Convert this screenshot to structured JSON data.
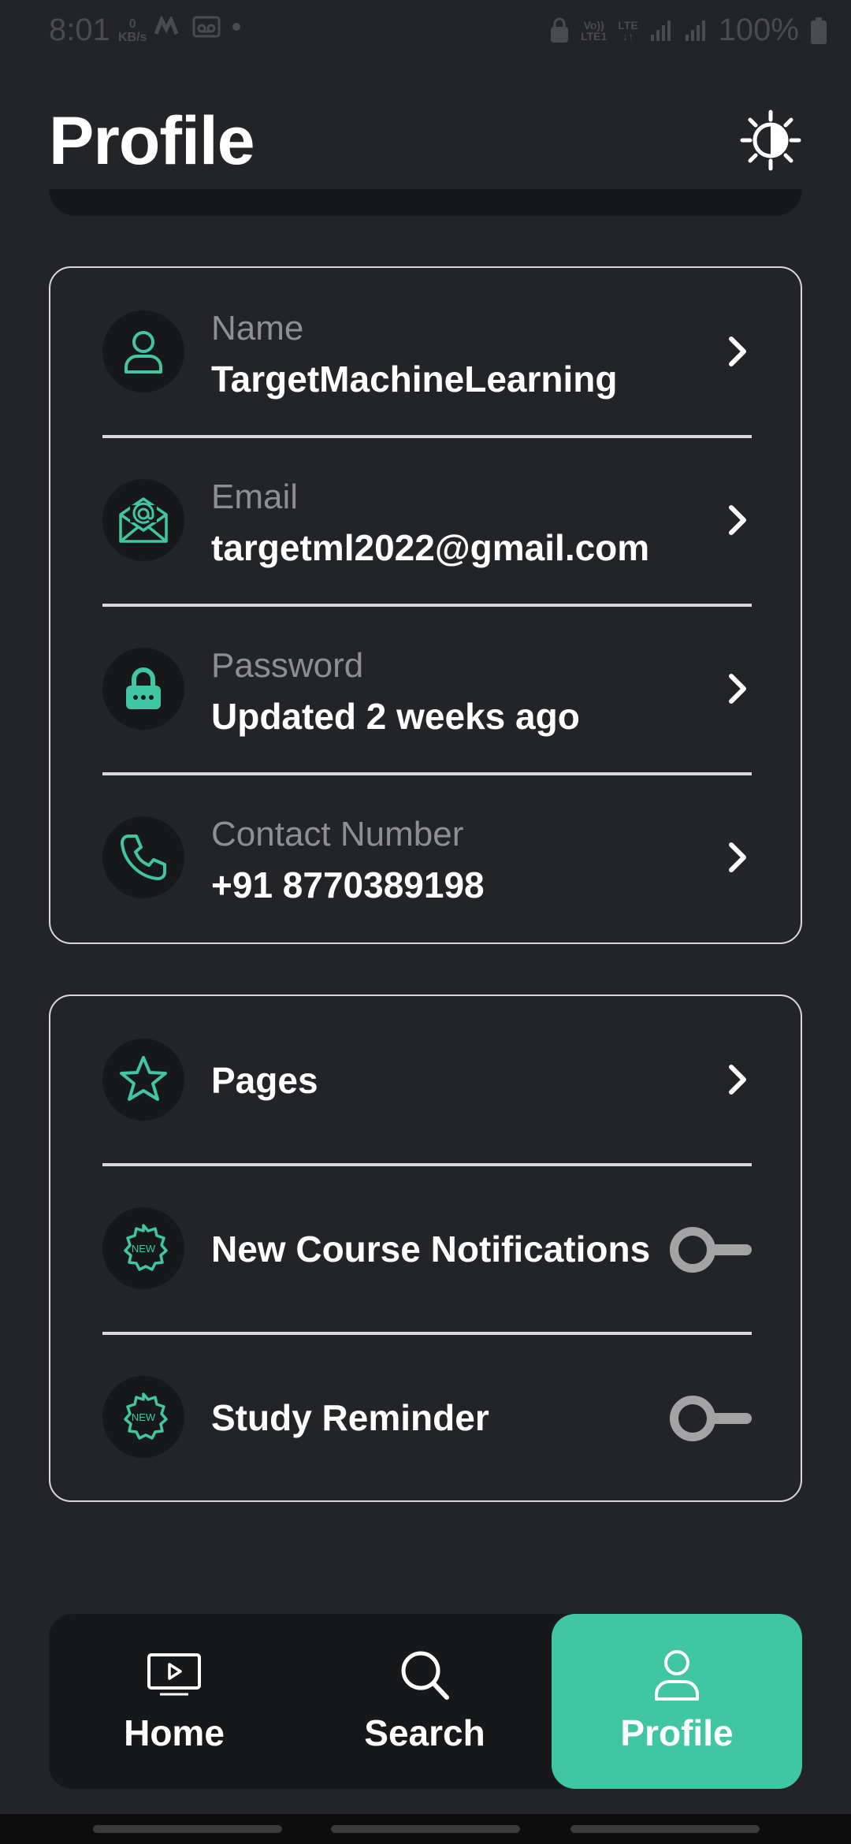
{
  "status_bar": {
    "time": "8:01",
    "net_speed_value": "0",
    "net_speed_unit": "KB/s",
    "network_volte": "Vo))",
    "network_lte1": "LTE1",
    "network_lte": "LTE",
    "battery": "100%"
  },
  "header": {
    "title": "Profile"
  },
  "account": {
    "items": [
      {
        "label": "Name",
        "value": "TargetMachineLearning",
        "icon": "user-icon"
      },
      {
        "label": "Email",
        "value": "targetml2022@gmail.com",
        "icon": "email-icon"
      },
      {
        "label": "Password",
        "value": "Updated 2 weeks ago",
        "icon": "lock-icon"
      },
      {
        "label": "Contact Number",
        "value": "+91 8770389198",
        "icon": "phone-icon"
      }
    ]
  },
  "settings": {
    "items": [
      {
        "label": "Pages",
        "icon": "star-icon",
        "control": "chevron"
      },
      {
        "label": "New Course Notifications",
        "icon": "new-badge-icon",
        "control": "toggle",
        "enabled": false
      },
      {
        "label": "Study Reminder",
        "icon": "new-badge-icon",
        "control": "toggle",
        "enabled": false
      }
    ],
    "badge_text": "NEW"
  },
  "nav": {
    "home": "Home",
    "search": "Search",
    "profile": "Profile",
    "active": "profile"
  },
  "colors": {
    "background": "#232427",
    "accent": "#41c6a4",
    "card_border": "#d9d9d9",
    "muted_text": "#8e8f92"
  }
}
